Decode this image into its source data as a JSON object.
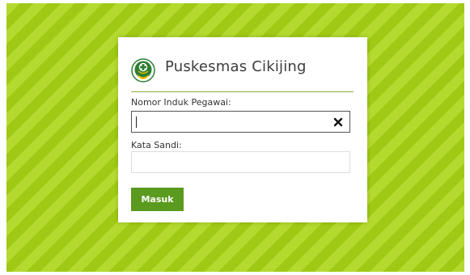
{
  "header": {
    "title": "Puskesmas Cikijing",
    "logo_icon": "kemenkes-logo-icon"
  },
  "form": {
    "nip_label": "Nomor Induk Pegawai:",
    "nip_value": "",
    "nip_placeholder": "",
    "clear_icon": "close-icon",
    "password_label": "Kata Sandi:",
    "password_value": "",
    "password_placeholder": "",
    "submit_label": "Masuk"
  },
  "colors": {
    "background_stripe_light": "#b4d92f",
    "background_stripe_dark": "#9fc914",
    "accent": "#5a9a1e",
    "divider": "#8aac3a",
    "logo_green": "#2e7d32",
    "logo_yellow": "#f2c200"
  }
}
